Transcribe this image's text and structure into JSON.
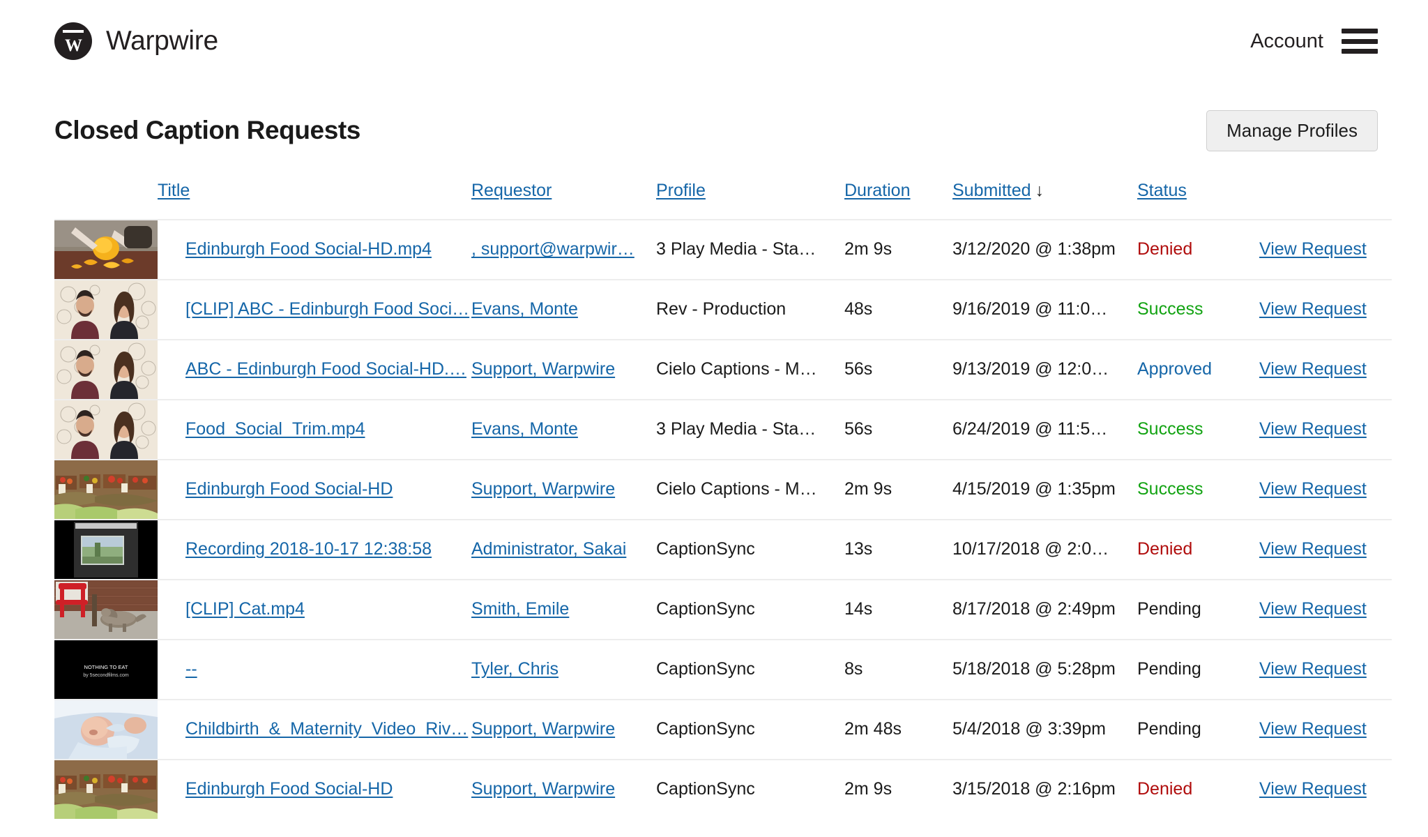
{
  "header": {
    "brand_name": "Warpwire",
    "brand_mark_letter": "W",
    "account_label": "Account",
    "menu_icon": "hamburger-menu-icon"
  },
  "page": {
    "title": "Closed Caption Requests",
    "manage_profiles_label": "Manage Profiles"
  },
  "table": {
    "columns": [
      {
        "key": "thumbnail",
        "label": ""
      },
      {
        "key": "title",
        "label": "Title",
        "sortable": true
      },
      {
        "key": "requestor",
        "label": "Requestor",
        "sortable": true
      },
      {
        "key": "profile",
        "label": "Profile",
        "sortable": true
      },
      {
        "key": "duration",
        "label": "Duration",
        "sortable": true
      },
      {
        "key": "submitted",
        "label": "Submitted",
        "sortable": true,
        "sort_indicator": "↓"
      },
      {
        "key": "status",
        "label": "Status",
        "sortable": true
      },
      {
        "key": "action",
        "label": ""
      }
    ],
    "action_label": "View Request",
    "rows": [
      {
        "thumbnail": "squash-cutting-board-thumbnail",
        "title": "Edinburgh Food Social-HD.mp4",
        "requestor": ", support@warpwir…",
        "profile": "3 Play Media - Sta…",
        "duration": "2m 9s",
        "submitted": "3/12/2020 @ 1:38pm",
        "status": "Denied",
        "status_kind": "denied",
        "action": "View Request"
      },
      {
        "thumbnail": "two-people-interview-thumbnail",
        "title": "[CLIP] ABC - Edinburgh Food Soci…",
        "requestor": "Evans, Monte",
        "profile": "Rev - Production",
        "duration": "48s",
        "submitted": "9/16/2019 @ 11:0…",
        "status": "Success",
        "status_kind": "success",
        "action": "View Request"
      },
      {
        "thumbnail": "two-people-interview-thumbnail",
        "title": "ABC - Edinburgh Food Social-HD.…",
        "requestor": "Support, Warpwire",
        "profile": "Cielo Captions - M…",
        "duration": "56s",
        "submitted": "9/13/2019 @ 12:0…",
        "status": "Approved",
        "status_kind": "approved",
        "action": "View Request"
      },
      {
        "thumbnail": "two-people-interview-thumbnail",
        "title": "Food_Social_Trim.mp4",
        "requestor": "Evans, Monte",
        "profile": "3 Play Media - Sta…",
        "duration": "56s",
        "submitted": "6/24/2019 @ 11:5…",
        "status": "Success",
        "status_kind": "success",
        "action": "View Request"
      },
      {
        "thumbnail": "market-produce-stall-thumbnail",
        "title": "Edinburgh Food Social-HD",
        "requestor": "Support, Warpwire",
        "profile": "Cielo Captions - M…",
        "duration": "2m 9s",
        "submitted": "4/15/2019 @ 1:35pm",
        "status": "Success",
        "status_kind": "success",
        "action": "View Request"
      },
      {
        "thumbnail": "screen-recording-thumbnail",
        "title": "Recording 2018-10-17 12:38:58",
        "requestor": "Administrator, Sakai",
        "profile": "CaptionSync",
        "duration": "13s",
        "submitted": "10/17/2018 @ 2:0…",
        "status": "Denied",
        "status_kind": "denied",
        "action": "View Request"
      },
      {
        "thumbnail": "cat-red-chair-thumbnail",
        "title": "[CLIP] Cat.mp4",
        "requestor": "Smith, Emile",
        "profile": "CaptionSync",
        "duration": "14s",
        "submitted": "8/17/2018 @ 2:49pm",
        "status": "Pending",
        "status_kind": "pending",
        "action": "View Request"
      },
      {
        "thumbnail": "nothing-to-eat-titlecard-thumbnail",
        "thumbnail_text_line1": "NOTHING TO EAT",
        "thumbnail_text_line2": "by 5secondfilms.com",
        "title": "--",
        "requestor": "Tyler, Chris",
        "profile": "CaptionSync",
        "duration": "8s",
        "submitted": "5/18/2018 @ 5:28pm",
        "status": "Pending",
        "status_kind": "pending",
        "action": "View Request"
      },
      {
        "thumbnail": "newborn-baby-thumbnail",
        "title": "Childbirth_&_Maternity_Video_Riv…",
        "requestor": "Support, Warpwire",
        "profile": "CaptionSync",
        "duration": "2m 48s",
        "submitted": "5/4/2018 @ 3:39pm",
        "status": "Pending",
        "status_kind": "pending",
        "action": "View Request"
      },
      {
        "thumbnail": "market-produce-stall-thumbnail",
        "title": "Edinburgh Food Social-HD",
        "requestor": "Support, Warpwire",
        "profile": "CaptionSync",
        "duration": "2m 9s",
        "submitted": "3/15/2018 @ 2:16pm",
        "status": "Denied",
        "status_kind": "denied",
        "action": "View Request"
      }
    ]
  },
  "colors": {
    "link": "#1566a8",
    "denied": "#b00c0c",
    "success": "#12a312",
    "approved": "#1566a8",
    "pending": "#1a1a1a",
    "brand_dark": "#231f20",
    "button_bg": "#efefef"
  }
}
